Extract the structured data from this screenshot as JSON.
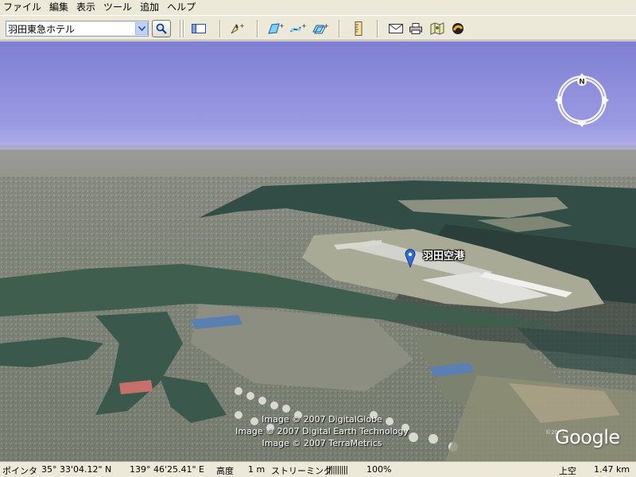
{
  "menu": [
    "ファイル",
    "編集",
    "表示",
    "ツール",
    "追加",
    "ヘルプ"
  ],
  "search": {
    "value": "羽田東急ホテル"
  },
  "toolbar": {
    "buttons": [
      "sidebar-toggle-icon",
      "placemark-add-icon",
      "polygon-add-icon",
      "path-add-icon",
      "image-overlay-add-icon",
      "ruler-icon",
      "email-icon",
      "print-icon",
      "google-maps-icon",
      "sky-icon"
    ]
  },
  "map": {
    "placemark_label": "羽田空港",
    "attribution": [
      "Image © 2007 DigitalGlobe",
      "Image © 2007 Digital Earth Technology",
      "Image © 2007 TerraMetrics"
    ],
    "logo": "Google",
    "small_copyright": "©2007",
    "compass_direction": "N"
  },
  "status": {
    "pointer_label": "ポインタ",
    "latitude": "35° 33'04.12\" N",
    "longitude": "139° 46'25.41\" E",
    "altitude_label": "高度",
    "altitude_value": "1 m",
    "streaming_label": "ストリーミング",
    "streaming_bar": "||||||||||",
    "streaming_percent": "100%",
    "eye_label": "上空",
    "eye_value": "1.47 km"
  },
  "colors": {
    "sky": "#8f8fd8",
    "water": "#2f4a44",
    "land": "#7a8670"
  }
}
